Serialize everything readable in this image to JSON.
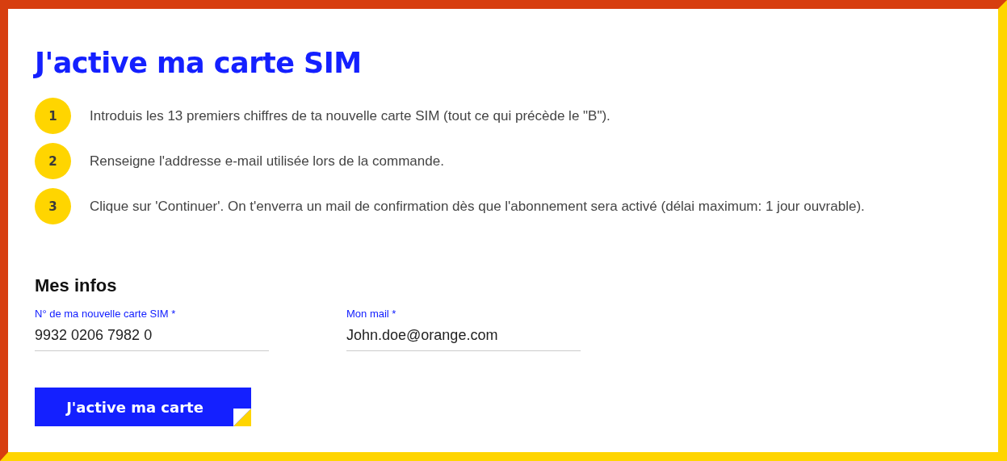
{
  "title": "J'active ma carte SIM",
  "steps": [
    {
      "number": "1",
      "text": "Introduis les 13 premiers chiffres de ta nouvelle carte SIM (tout ce qui précède le \"B\")."
    },
    {
      "number": "2",
      "text": "Renseigne l'addresse e-mail utilisée lors de la commande."
    },
    {
      "number": "3",
      "text": "Clique sur 'Continuer'. On t'enverra un mail de confirmation dès que l'abonnement sera activé (délai maximum: 1 jour ouvrable)."
    }
  ],
  "section_title": "Mes infos",
  "fields": [
    {
      "label": "N° de ma nouvelle carte SIM *",
      "value": "9932 0206 7982 0"
    },
    {
      "label": "Mon mail *",
      "value": "John.doe@orange.com"
    }
  ],
  "submit_button": "J'active ma carte"
}
